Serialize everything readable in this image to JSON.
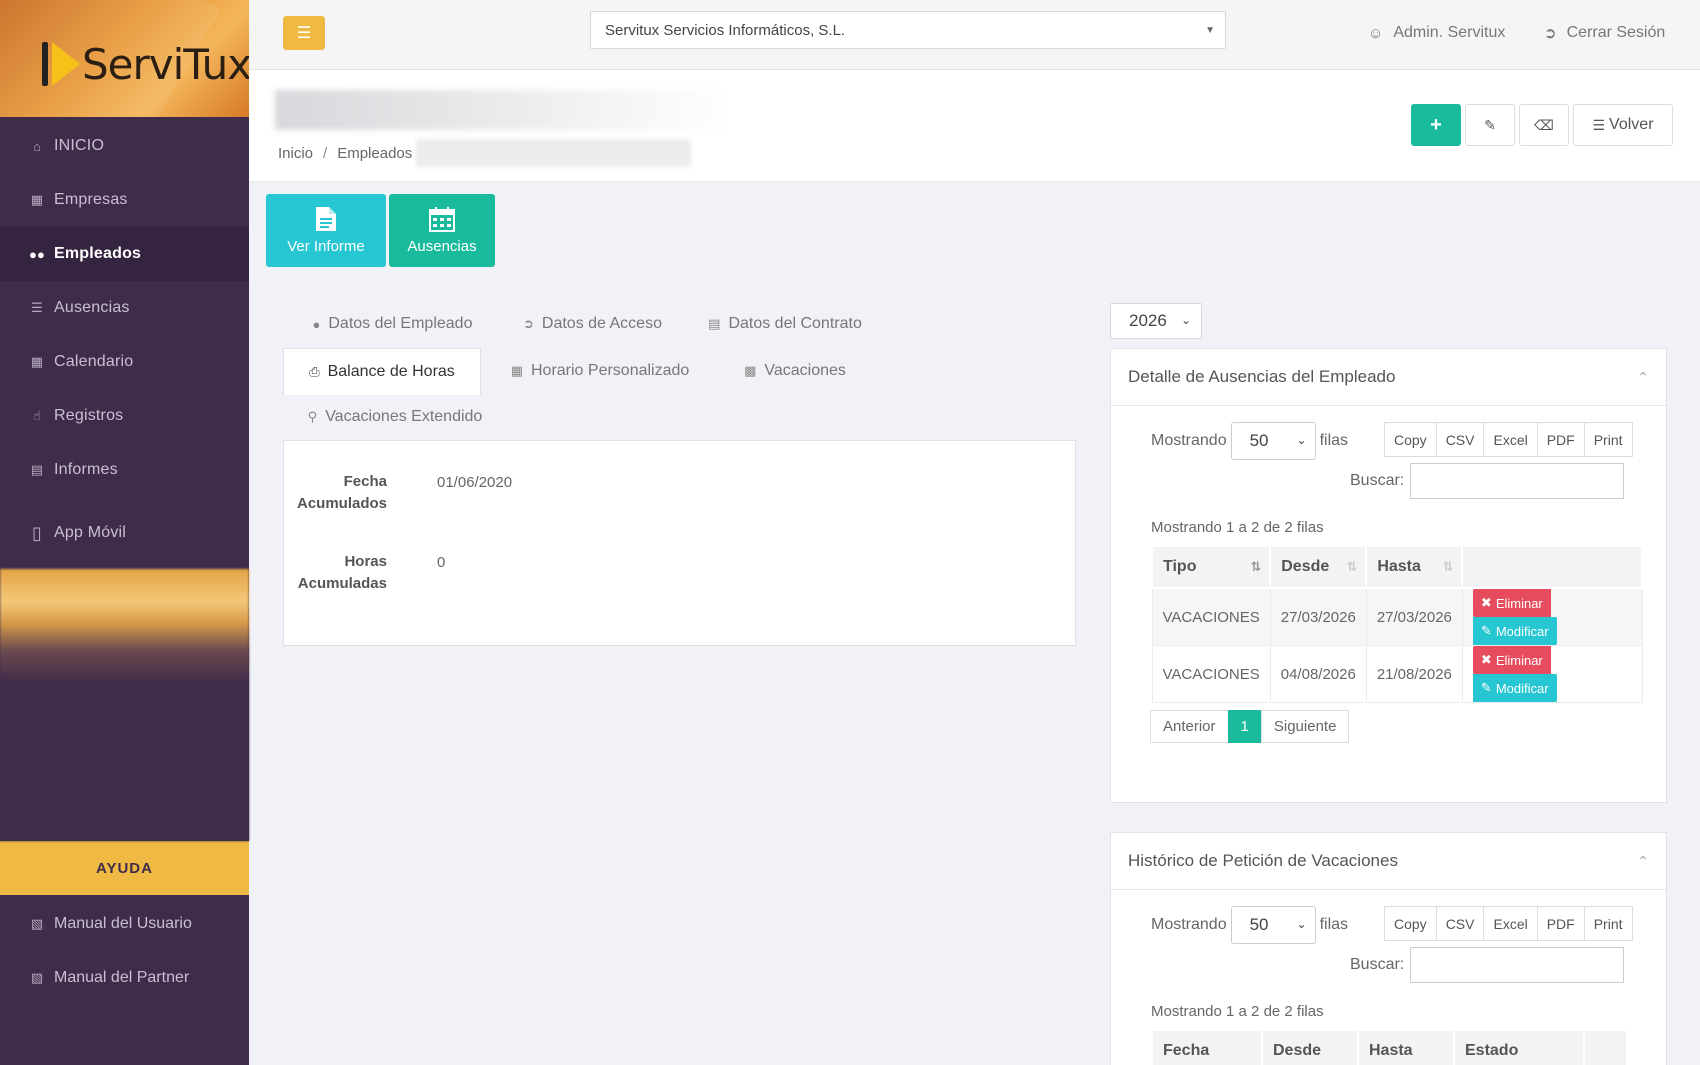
{
  "brand": {
    "logo_text": "ServiTux"
  },
  "sidebar": {
    "items": [
      {
        "label": "INICIO"
      },
      {
        "label": "Empresas"
      },
      {
        "label": "Empleados"
      },
      {
        "label": "Ausencias"
      },
      {
        "label": "Calendario"
      },
      {
        "label": "Registros"
      },
      {
        "label": "Informes"
      },
      {
        "label": "App Móvil"
      }
    ],
    "help": "AYUDA",
    "manuals": [
      {
        "label": "Manual del Usuario"
      },
      {
        "label": "Manual del Partner"
      }
    ]
  },
  "topbar": {
    "company": "Servitux Servicios Informáticos, S.L.",
    "user": "Admin. Servitux",
    "logout": "Cerrar Sesión"
  },
  "breadcrumb": {
    "home": "Inicio",
    "employees": "Empleados"
  },
  "header_buttons": {
    "add": "+",
    "back": "Volver"
  },
  "tiles": {
    "report": "Ver Informe",
    "absences": "Ausencias"
  },
  "tabs": [
    {
      "label": "Datos del Empleado"
    },
    {
      "label": "Datos de Acceso"
    },
    {
      "label": "Datos del Contrato"
    },
    {
      "label": "Balance de Horas"
    },
    {
      "label": "Horario Personalizado"
    },
    {
      "label": "Vacaciones"
    },
    {
      "label": "Vacaciones Extendido"
    }
  ],
  "balance": {
    "date_label_1": "Fecha",
    "date_label_2": "Acumulados",
    "date_value": "01/06/2020",
    "hours_label_1": "Horas",
    "hours_label_2": "Acumuladas",
    "hours_value": "0"
  },
  "year": "2026",
  "absences_panel": {
    "title": "Detalle de Ausencias del Empleado",
    "showing": "Mostrando",
    "page_len": "50",
    "rows_word": "filas",
    "exports": [
      "Copy",
      "CSV",
      "Excel",
      "PDF",
      "Print"
    ],
    "search_label": "Buscar:",
    "info": "Mostrando 1 a 2 de 2 filas",
    "columns": [
      "Tipo",
      "Desde",
      "Hasta"
    ],
    "rows": [
      {
        "tipo": "VACACIONES",
        "desde": "27/03/2026",
        "hasta": "27/03/2026"
      },
      {
        "tipo": "VACACIONES",
        "desde": "04/08/2026",
        "hasta": "21/08/2026"
      }
    ],
    "delete_label": "Eliminar",
    "modify_label": "Modificar",
    "prev": "Anterior",
    "page": "1",
    "next": "Siguiente"
  },
  "history_panel": {
    "title": "Histórico de Petición de Vacaciones",
    "showing": "Mostrando",
    "page_len": "50",
    "rows_word": "filas",
    "exports": [
      "Copy",
      "CSV",
      "Excel",
      "PDF",
      "Print"
    ],
    "search_label": "Buscar:",
    "info": "Mostrando 1 a 2 de 2 filas",
    "columns": [
      "Fecha",
      "Desde",
      "Hasta",
      "Estado"
    ]
  }
}
